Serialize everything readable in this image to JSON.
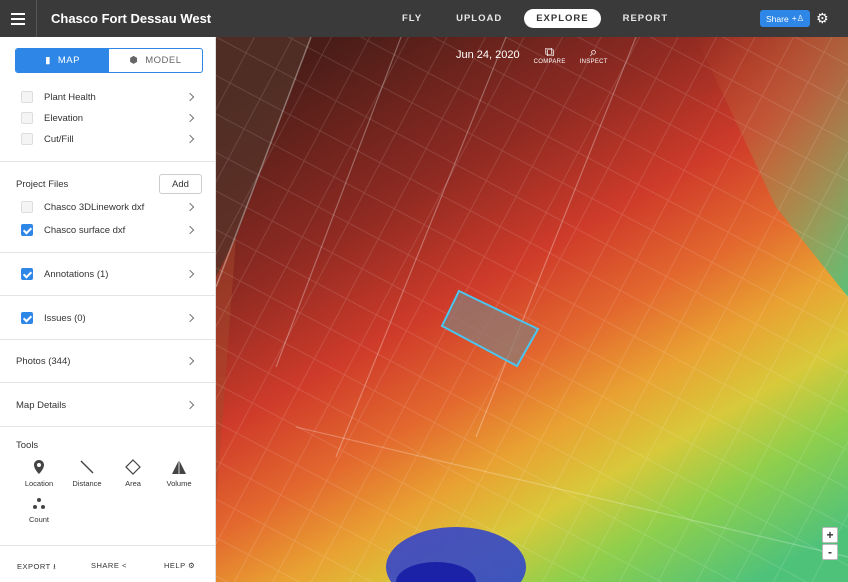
{
  "topbar": {
    "title": "Chasco Fort Dessau West",
    "nav": [
      "FLY",
      "UPLOAD",
      "EXPLORE",
      "REPORT"
    ],
    "active_nav": "EXPLORE",
    "share_label": "Share"
  },
  "sidebar": {
    "view_toggle": {
      "map_label": "MAP",
      "model_label": "MODEL"
    },
    "layers": [
      {
        "label": "Plant Health",
        "checked": false
      },
      {
        "label": "Elevation",
        "checked": false
      },
      {
        "label": "Cut/Fill",
        "checked": false
      }
    ],
    "project_files": {
      "title": "Project Files",
      "add_label": "Add",
      "files": [
        {
          "label": "Chasco 3DLinework dxf",
          "checked": false
        },
        {
          "label": "Chasco surface dxf",
          "checked": true
        }
      ]
    },
    "annotations_label": "Annotations (1)",
    "issues_label": "Issues (0)",
    "photos_label": "Photos (344)",
    "map_details_label": "Map Details",
    "tools": {
      "title": "Tools",
      "items": [
        "Location",
        "Distance",
        "Area",
        "Volume",
        "Count"
      ]
    },
    "footer": {
      "export": "EXPORT",
      "share": "SHARE",
      "help": "HELP"
    }
  },
  "map": {
    "date": "Jun 24, 2020",
    "compare_label": "COMPARE",
    "inspect_label": "INSPECT",
    "zoom_in": "+",
    "zoom_out": "-"
  },
  "colors": {
    "accent": "#2e86e6",
    "topbar": "#3a3a3a"
  }
}
